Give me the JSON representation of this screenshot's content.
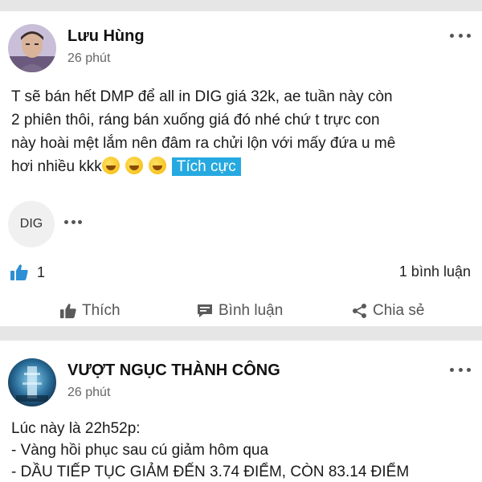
{
  "colors": {
    "accent": "#26a9e0",
    "like_icon": "#2d8fd5",
    "separator": "#e6e6e6"
  },
  "posts": [
    {
      "author": "Lưu Hùng",
      "time": "26 phút",
      "text_lines": [
        "T sẽ bán hết DMP để all in DIG giá 32k, ae tuần này còn",
        "2 phiên thôi, ráng bán xuống giá đó nhé chứ t trực con",
        "này hoài mệt lắm nên đâm ra chửi lộn với mấy đứa u mê",
        "hơi nhiều kkk"
      ],
      "emoji_icon": "rofl-emoji-icon",
      "sentiment_label": "Tích cực",
      "stock_tag": "DIG",
      "like_count": "1",
      "comment_count": "1 bình luận",
      "actions": {
        "like": "Thích",
        "comment": "Bình luận",
        "share": "Chia sẻ"
      }
    },
    {
      "author": "VƯỢT NGỤC THÀNH CÔNG",
      "time": "26 phút",
      "text_lines": [
        "Lúc này là 22h52p:",
        "- Vàng hồi phục sau cú giảm hôm qua",
        "- DẦU TIẾP TỤC GIẢM ĐẾN 3.74 ĐIỂM, CÒN 83.14 ĐIỂM"
      ]
    }
  ]
}
